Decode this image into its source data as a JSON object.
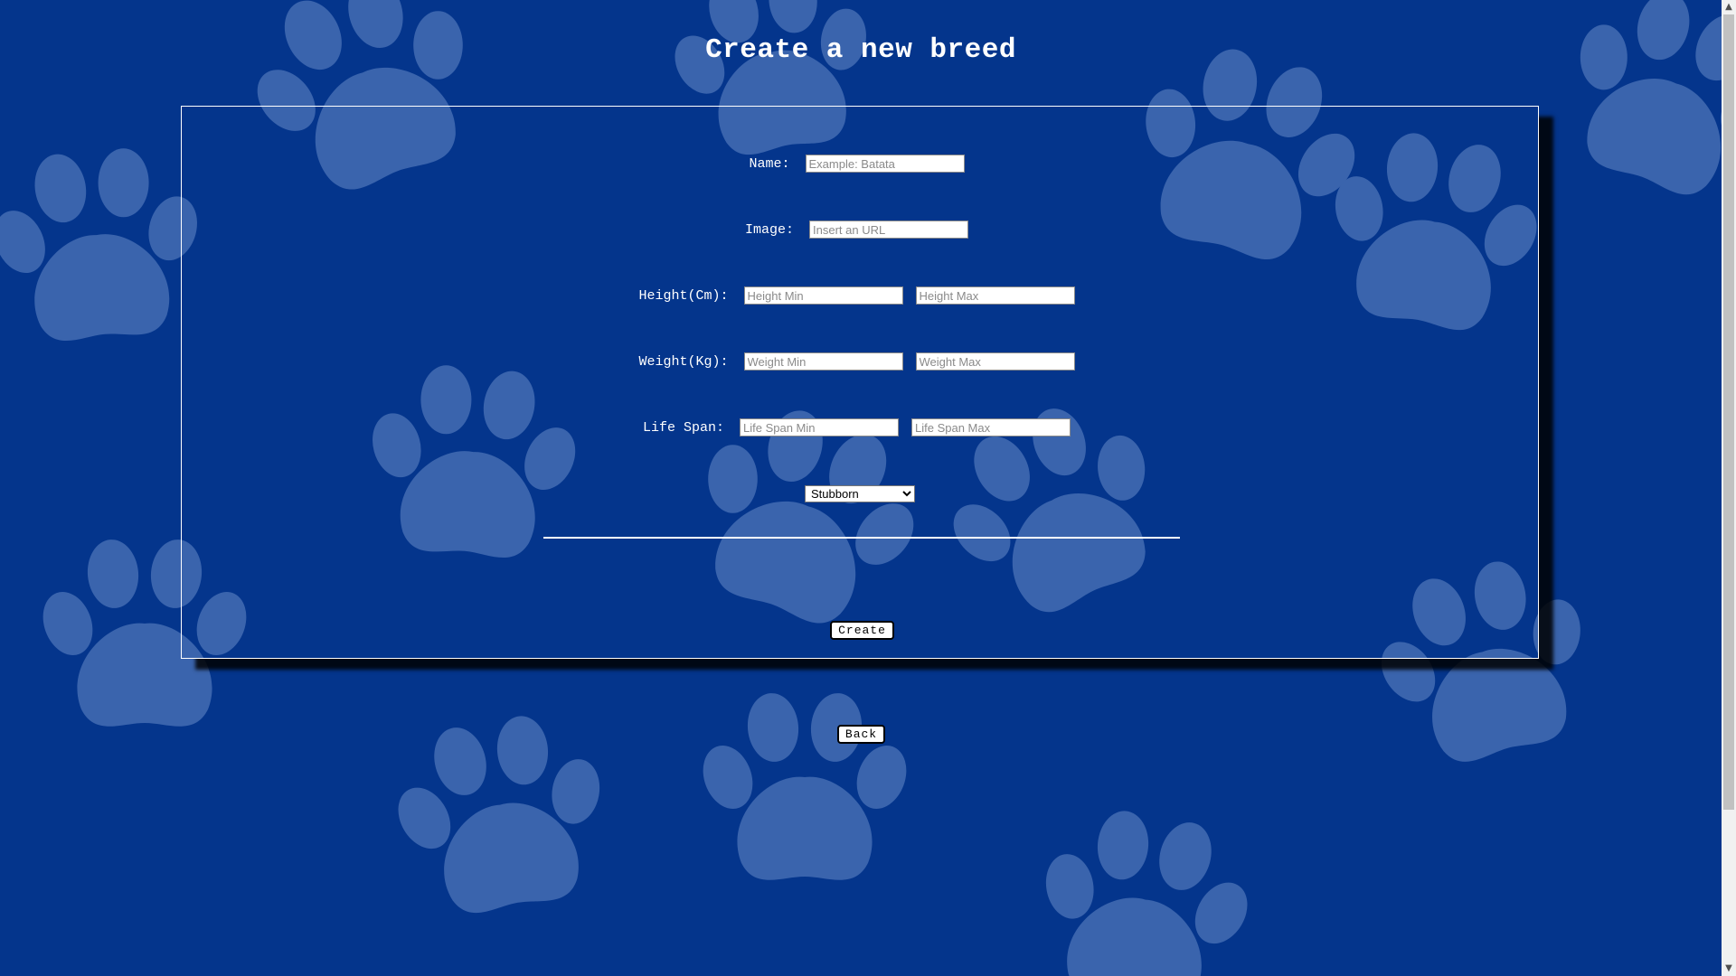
{
  "page": {
    "title": "Create a new breed"
  },
  "form": {
    "name": {
      "label": "Name:",
      "placeholder": "Example: Batata",
      "value": ""
    },
    "image": {
      "label": "Image:",
      "placeholder": "Insert an URL",
      "value": ""
    },
    "height": {
      "label": "Height(Cm):",
      "min_placeholder": "Height Min",
      "max_placeholder": "Height Max"
    },
    "weight": {
      "label": "Weight(Kg):",
      "min_placeholder": "Weight Min",
      "max_placeholder": "Weight Max"
    },
    "life_span": {
      "label": "Life Span:",
      "min_placeholder": "Life Span Min",
      "max_placeholder": "Life Span Max"
    },
    "temperament": {
      "selected": "Stubborn"
    },
    "create_label": "Create"
  },
  "actions": {
    "back_label": "Back"
  },
  "colors": {
    "background": "#04358c",
    "paw": "#3a64ad",
    "text": "#ffffff"
  },
  "icons": {
    "background_pattern": "paw-print-icon",
    "scroll_up": "chevron-up-icon",
    "scroll_down": "chevron-down-icon"
  }
}
